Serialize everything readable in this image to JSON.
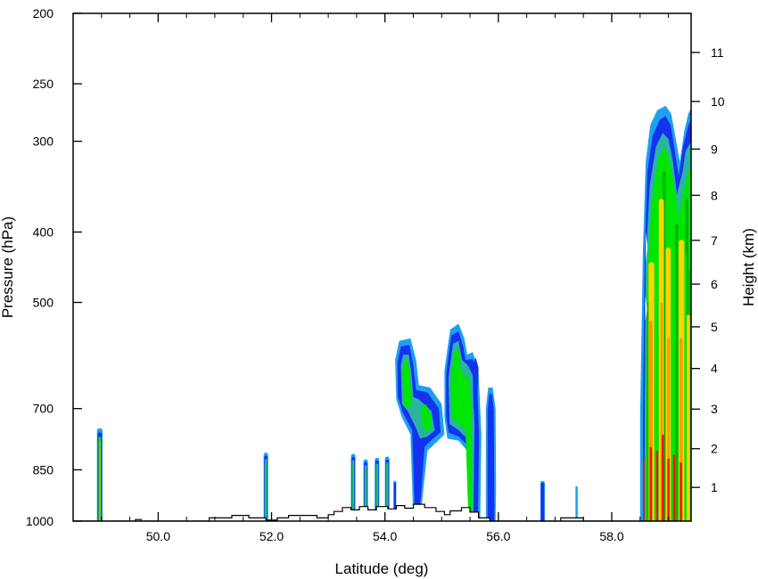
{
  "chart_data": {
    "type": "contour-cross-section",
    "xlabel": "Latitude (deg)",
    "ylabel": "Pressure (hPa)",
    "y2label": "Height (km)",
    "xlim": [
      48.5,
      59.4
    ],
    "ylim": [
      1000,
      200
    ],
    "y_scale": "log-pressure",
    "x_ticks": [
      50.0,
      52.0,
      54.0,
      56.0,
      58.0
    ],
    "x_tick_labels": [
      "50.0",
      "52.0",
      "54.0",
      "56.0",
      "58.0"
    ],
    "y_ticks": [
      1000,
      850,
      700,
      500,
      400,
      300,
      250,
      200
    ],
    "y_tick_labels": [
      "1000",
      "850",
      "700",
      "500",
      "400",
      "300",
      "250",
      "200"
    ],
    "y2_ticks": [
      1,
      2,
      3,
      4,
      5,
      6,
      7,
      8,
      9,
      10,
      11
    ],
    "y2_tick_labels": [
      "1",
      "2",
      "3",
      "4",
      "5",
      "6",
      "7",
      "8",
      "9",
      "10",
      "11"
    ],
    "grid": false,
    "legend": "none",
    "colors": {
      "light_blue": "#1ea0f0",
      "blue": "#1432f0",
      "teal": "#2ab4a0",
      "green": "#00e600",
      "dark_green": "#00b400",
      "yellow": "#ffd200",
      "orange": "#ff9600",
      "red": "#f01414",
      "terrain": "#000000"
    },
    "terrain": [
      [
        48.5,
        1000
      ],
      [
        49.6,
        1000
      ],
      [
        49.6,
        995
      ],
      [
        49.7,
        995
      ],
      [
        49.7,
        1000
      ],
      [
        50.9,
        1000
      ],
      [
        50.9,
        990
      ],
      [
        51.3,
        990
      ],
      [
        51.3,
        982
      ],
      [
        51.6,
        982
      ],
      [
        51.6,
        990
      ],
      [
        51.9,
        990
      ],
      [
        51.9,
        997
      ],
      [
        52.1,
        997
      ],
      [
        52.1,
        990
      ],
      [
        52.3,
        990
      ],
      [
        52.3,
        982
      ],
      [
        52.8,
        982
      ],
      [
        52.8,
        990
      ],
      [
        53.0,
        990
      ],
      [
        53.0,
        980
      ],
      [
        53.1,
        980
      ],
      [
        53.1,
        970
      ],
      [
        53.25,
        970
      ],
      [
        53.25,
        958
      ],
      [
        53.4,
        958
      ],
      [
        53.4,
        965
      ],
      [
        53.55,
        965
      ],
      [
        53.55,
        955
      ],
      [
        53.7,
        955
      ],
      [
        53.7,
        965
      ],
      [
        53.85,
        965
      ],
      [
        53.85,
        955
      ],
      [
        54.05,
        955
      ],
      [
        54.05,
        962
      ],
      [
        54.2,
        962
      ],
      [
        54.2,
        952
      ],
      [
        54.35,
        952
      ],
      [
        54.35,
        960
      ],
      [
        54.5,
        960
      ],
      [
        54.5,
        948
      ],
      [
        54.7,
        948
      ],
      [
        54.7,
        958
      ],
      [
        54.9,
        958
      ],
      [
        54.9,
        970
      ],
      [
        55.05,
        970
      ],
      [
        55.05,
        980
      ],
      [
        55.15,
        980
      ],
      [
        55.15,
        968
      ],
      [
        55.35,
        968
      ],
      [
        55.35,
        958
      ],
      [
        55.5,
        958
      ],
      [
        55.5,
        972
      ],
      [
        55.65,
        972
      ],
      [
        55.65,
        990
      ],
      [
        55.85,
        990
      ],
      [
        55.85,
        1000
      ],
      [
        57.1,
        1000
      ],
      [
        57.1,
        990
      ],
      [
        57.5,
        990
      ],
      [
        57.5,
        1000
      ],
      [
        59.4,
        1000
      ]
    ],
    "cells": [
      {
        "band": [
          [
            48.95,
            730
          ],
          [
            49.0,
            780
          ]
        ],
        "levels": [
          "light_blue",
          "blue",
          "green",
          "orange"
        ],
        "x0": 48.92,
        "x1": 49.02,
        "top": 745
      },
      {
        "band": [],
        "levels": [
          "light_blue",
          "blue",
          "teal",
          "green"
        ],
        "x0": 51.86,
        "x1": 51.94,
        "top": 805
      },
      {
        "band": [],
        "levels": [
          "light_blue",
          "blue",
          "teal",
          "green"
        ],
        "x0": 53.4,
        "x1": 53.48,
        "top": 808
      },
      {
        "band": [],
        "levels": [
          "light_blue",
          "blue",
          "teal",
          "green"
        ],
        "x0": 53.62,
        "x1": 53.7,
        "top": 822
      },
      {
        "band": [],
        "levels": [
          "light_blue",
          "blue",
          "teal",
          "green"
        ],
        "x0": 53.82,
        "x1": 53.9,
        "top": 818
      },
      {
        "band": [],
        "levels": [
          "light_blue",
          "blue",
          "teal",
          "green"
        ],
        "x0": 54.0,
        "x1": 54.08,
        "top": 815
      },
      {
        "band": [],
        "levels": [
          "light_blue",
          "blue"
        ],
        "x0": 54.15,
        "x1": 54.2,
        "top": 880
      },
      {
        "band": [],
        "levels": [
          "light_blue",
          "blue"
        ],
        "x0": 56.74,
        "x1": 56.82,
        "top": 880
      },
      {
        "band": [],
        "levels": [
          "light_blue"
        ],
        "x0": 57.36,
        "x1": 57.4,
        "top": 895
      }
    ]
  }
}
